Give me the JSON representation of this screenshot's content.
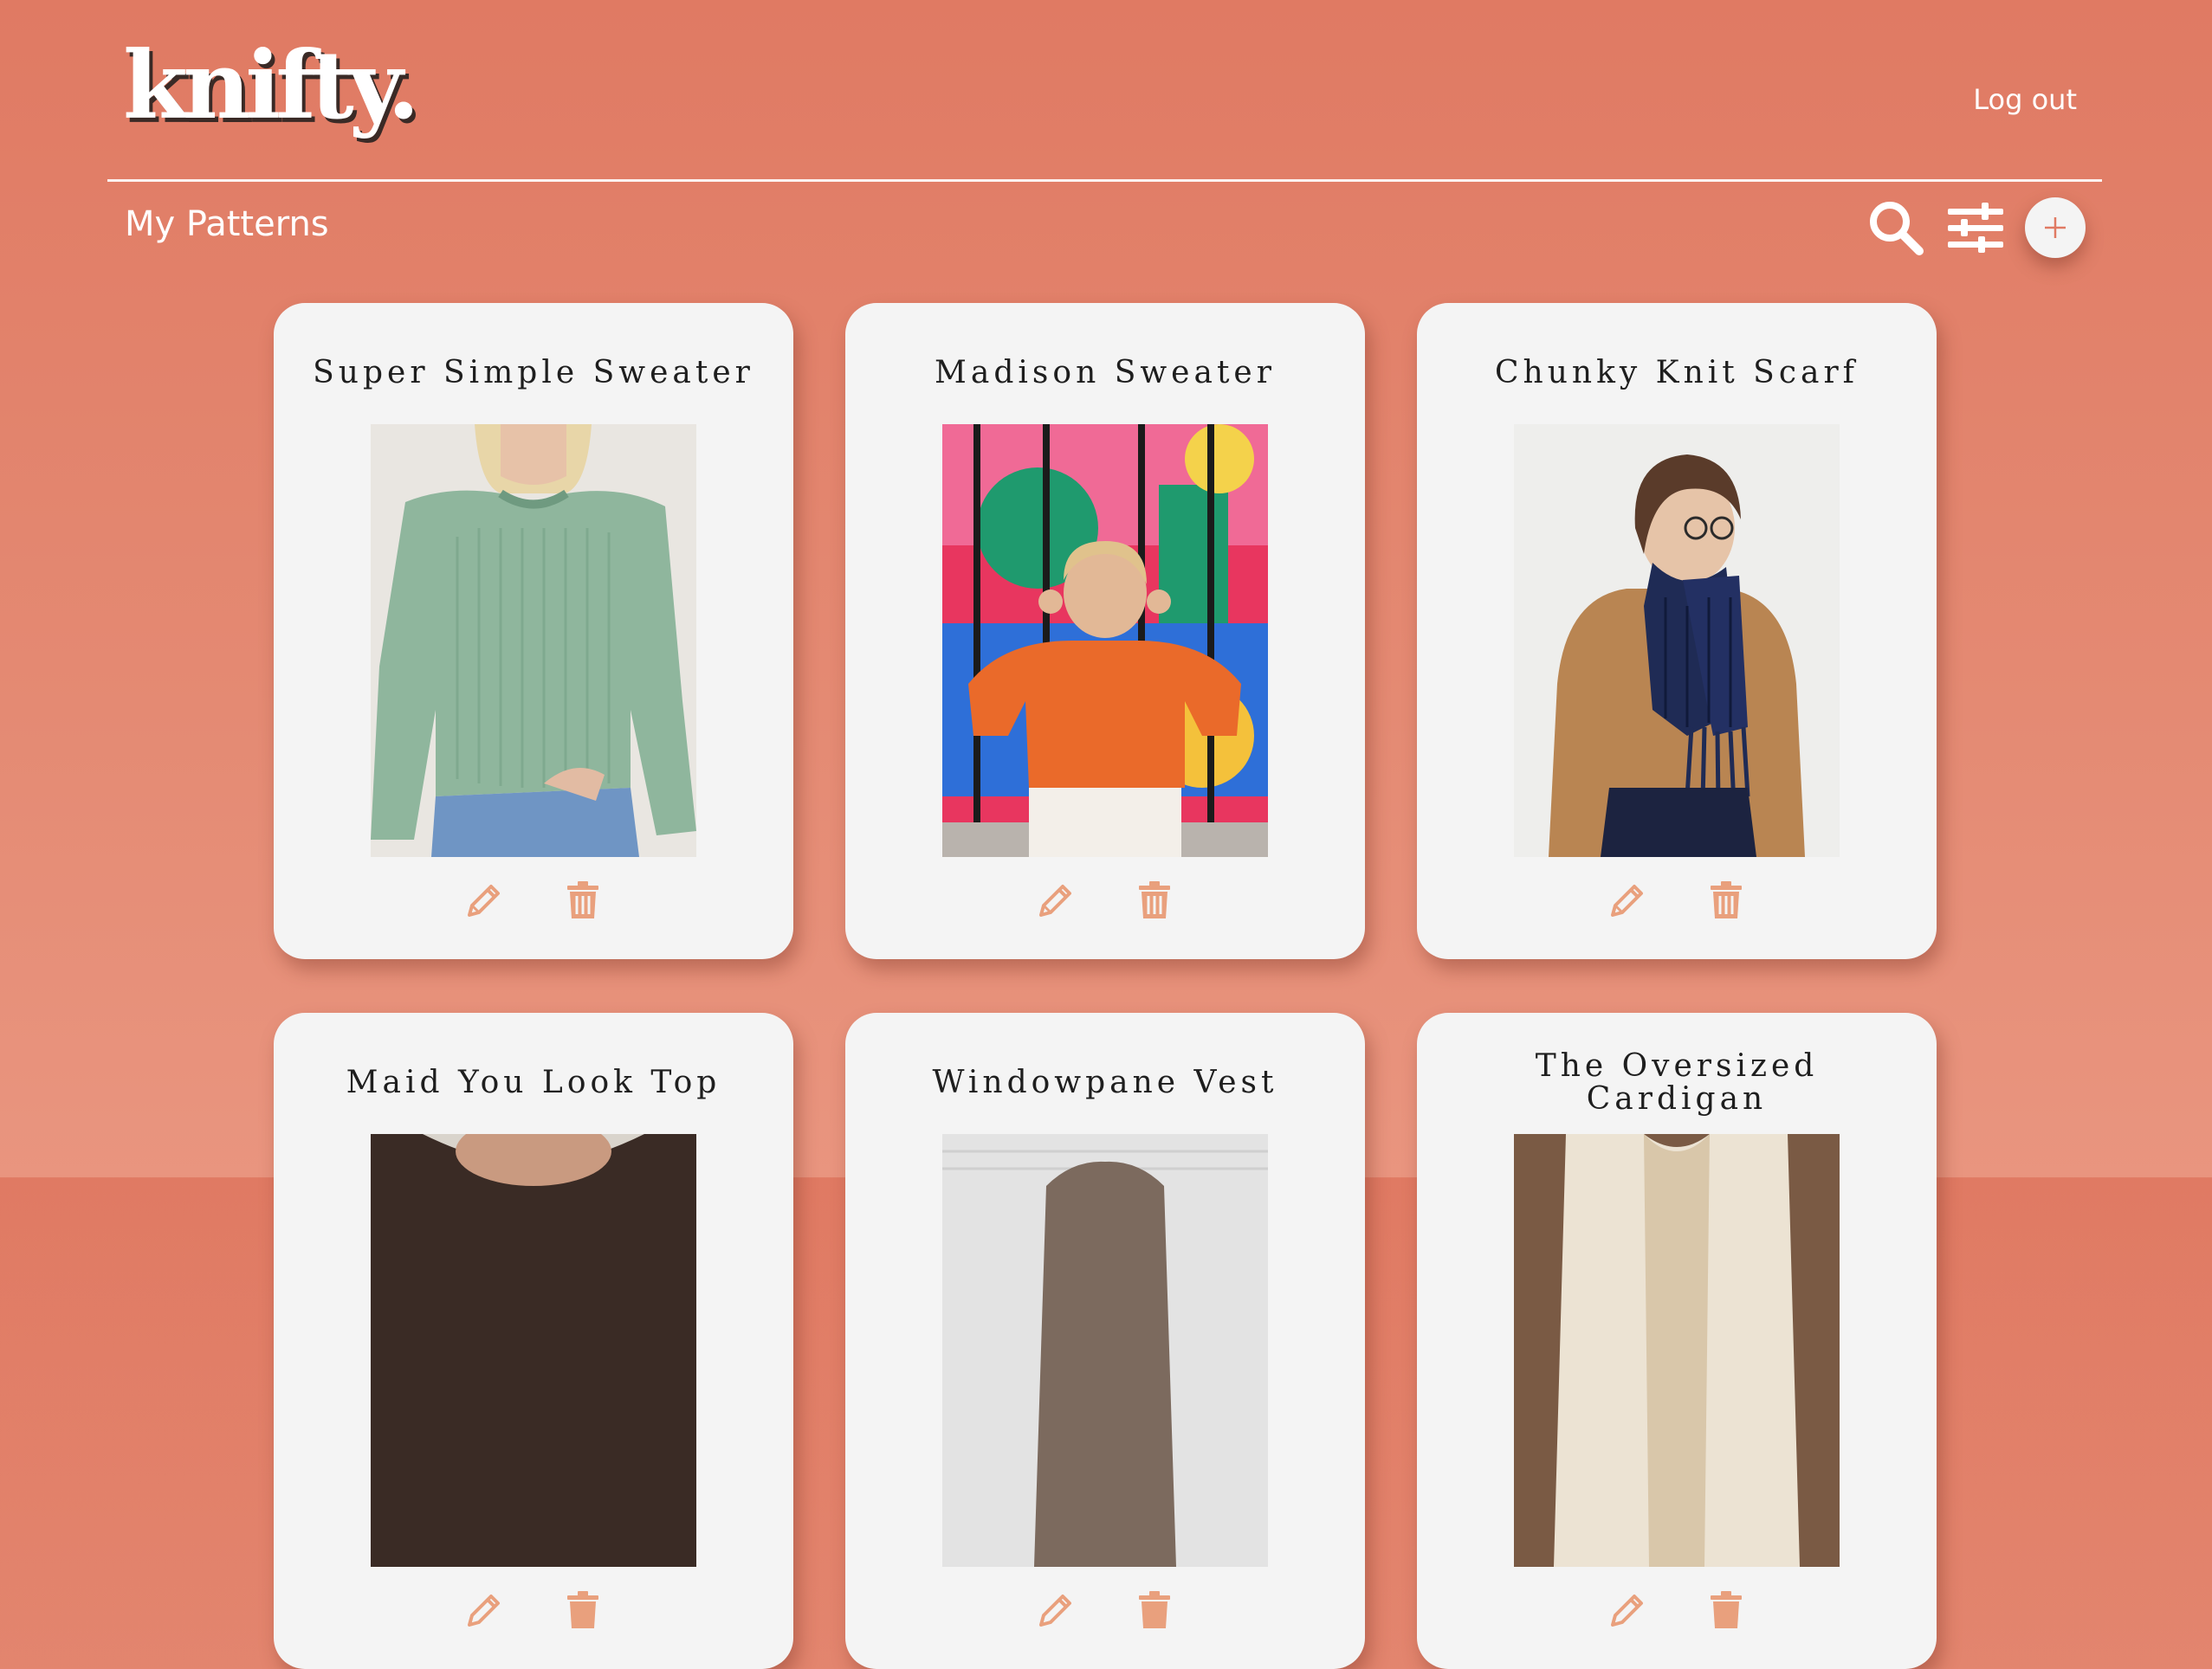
{
  "app": {
    "logo": "knifty."
  },
  "header": {
    "logout_label": "Log out"
  },
  "page": {
    "title": "My Patterns"
  },
  "toolbar": {
    "search_icon": "search-icon",
    "filter_icon": "sliders-icon",
    "add_icon": "plus-icon"
  },
  "colors": {
    "background": "#e07a63",
    "card": "#f4f4f4",
    "action_icon": "#e9a07d",
    "text_dark": "#1e1e1e"
  },
  "patterns": [
    {
      "title": "Super Simple Sweater",
      "image": "woman-green-chunky-sweater-photo",
      "edit_icon": "pencil-icon",
      "delete_icon": "trash-icon"
    },
    {
      "title": "Madison Sweater",
      "image": "woman-orange-sweater-colorful-wall-photo",
      "edit_icon": "pencil-icon",
      "delete_icon": "trash-icon"
    },
    {
      "title": "Chunky Knit Scarf",
      "image": "woman-navy-knit-scarf-photo",
      "edit_icon": "pencil-icon",
      "delete_icon": "trash-icon"
    },
    {
      "title": "Maid You Look Top",
      "image": "woman-knit-top-photo",
      "edit_icon": "pencil-icon",
      "delete_icon": "trash-icon"
    },
    {
      "title": "Windowpane Vest",
      "image": "knit-vest-photo",
      "edit_icon": "pencil-icon",
      "delete_icon": "trash-icon"
    },
    {
      "title": "The Oversized Cardigan",
      "image": "cream-oversized-cardigan-photo",
      "edit_icon": "pencil-icon",
      "delete_icon": "trash-icon"
    }
  ]
}
